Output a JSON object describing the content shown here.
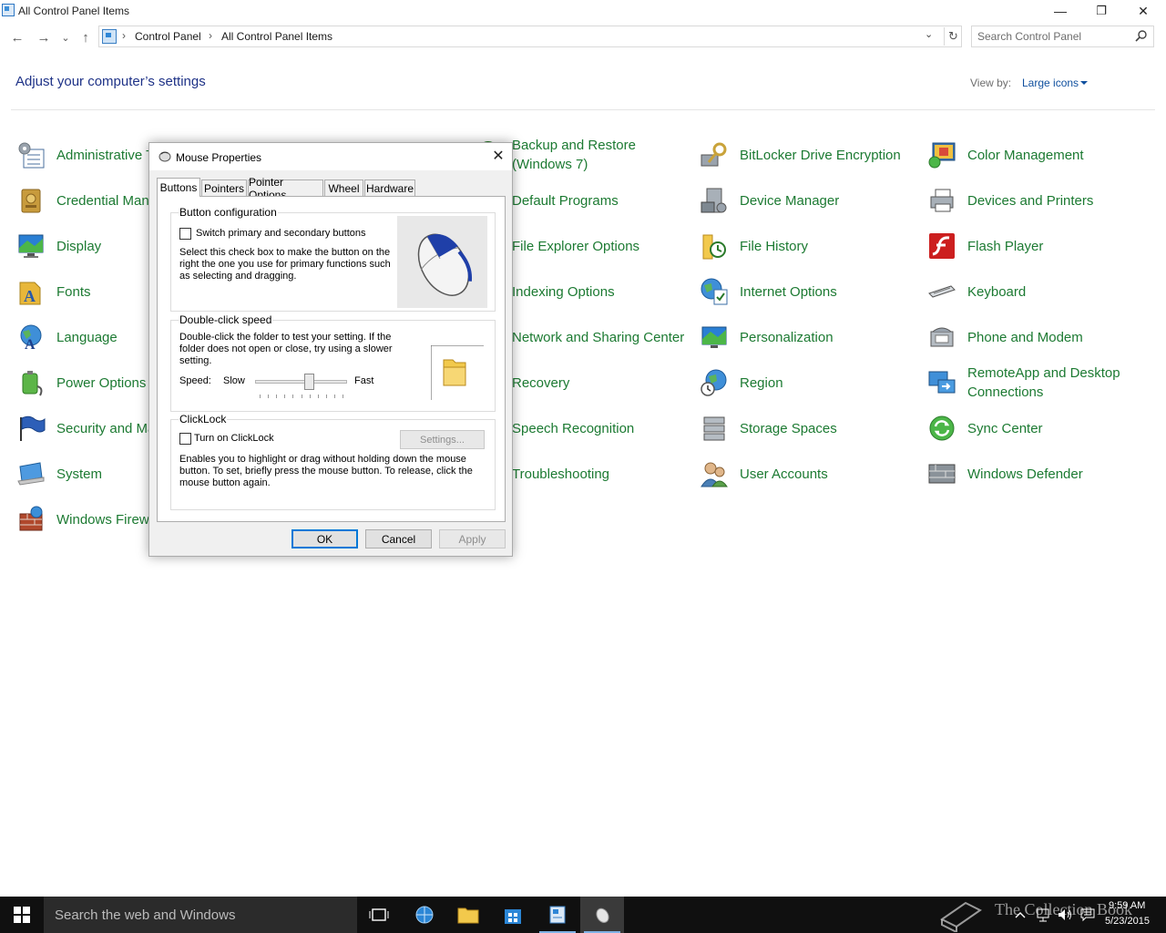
{
  "window": {
    "title": "All Control Panel Items",
    "minimize": "—",
    "restore": "❐",
    "close": "✕"
  },
  "nav": {
    "back": "←",
    "forward": "→",
    "recent": "⌄",
    "up": "↑",
    "breadcrumb": [
      "Control Panel",
      "All Control Panel Items"
    ],
    "sep": "›",
    "dropdown": "⌄",
    "refresh": "↻",
    "search_placeholder": "Search Control Panel"
  },
  "header": {
    "title": "Adjust your computer’s settings",
    "view_by_label": "View by:",
    "view_by_value": "Large icons"
  },
  "items": [
    {
      "label": "Administrative Tools",
      "icon": "administrative-tools-icon"
    },
    {
      "label": "Credential Manager",
      "icon": "credential-manager-icon"
    },
    {
      "label": "Display",
      "icon": "display-icon"
    },
    {
      "label": "Fonts",
      "icon": "fonts-icon"
    },
    {
      "label": "Language",
      "icon": "language-icon"
    },
    {
      "label": "Power Options",
      "icon": "power-options-icon"
    },
    {
      "label": "Security and Maintenance",
      "icon": "security-flag-icon"
    },
    {
      "label": "System",
      "icon": "system-icon"
    },
    {
      "label": "Windows Firewall",
      "icon": "firewall-icon"
    },
    {
      "label": "Backup and Restore (Windows 7)",
      "icon": "backup-icon"
    },
    {
      "label": "Default Programs",
      "icon": "default-programs-icon"
    },
    {
      "label": "File Explorer Options",
      "icon": "file-explorer-options-icon"
    },
    {
      "label": "Indexing Options",
      "icon": "indexing-options-icon"
    },
    {
      "label": "Network and Sharing Center",
      "icon": "network-icon"
    },
    {
      "label": "Recovery",
      "icon": "recovery-icon"
    },
    {
      "label": "Speech Recognition",
      "icon": "speech-recognition-icon"
    },
    {
      "label": "Troubleshooting",
      "icon": "troubleshooting-icon"
    },
    {
      "label": "BitLocker Drive Encryption",
      "icon": "bitlocker-icon"
    },
    {
      "label": "Device Manager",
      "icon": "device-manager-icon"
    },
    {
      "label": "File History",
      "icon": "file-history-icon"
    },
    {
      "label": "Internet Options",
      "icon": "internet-options-icon"
    },
    {
      "label": "Personalization",
      "icon": "personalization-icon"
    },
    {
      "label": "Region",
      "icon": "region-icon"
    },
    {
      "label": "Storage Spaces",
      "icon": "storage-spaces-icon"
    },
    {
      "label": "User Accounts",
      "icon": "user-accounts-icon"
    },
    {
      "label": "Color Management",
      "icon": "color-management-icon"
    },
    {
      "label": "Devices and Printers",
      "icon": "devices-printers-icon"
    },
    {
      "label": "Flash Player",
      "icon": "flash-player-icon"
    },
    {
      "label": "Keyboard",
      "icon": "keyboard-icon"
    },
    {
      "label": "Phone and Modem",
      "icon": "phone-modem-icon"
    },
    {
      "label": "RemoteApp and Desktop Connections",
      "icon": "remoteapp-icon"
    },
    {
      "label": "Sync Center",
      "icon": "sync-center-icon"
    },
    {
      "label": "Windows Defender",
      "icon": "windows-defender-icon"
    }
  ],
  "dialog": {
    "title": "Mouse Properties",
    "close": "✕",
    "tabs": [
      "Buttons",
      "Pointers",
      "Pointer Options",
      "Wheel",
      "Hardware"
    ],
    "active_tab": "Buttons",
    "button_config": {
      "group": "Button configuration",
      "checkbox_label": "Switch primary and secondary buttons",
      "checked": false,
      "description": "Select this check box to make the button on the right the one you use for primary functions such as selecting and dragging."
    },
    "double_click": {
      "group": "Double-click speed",
      "description": "Double-click the folder to test your setting. If the folder does not open or close, try using a slower setting.",
      "speed_label": "Speed:",
      "slow": "Slow",
      "fast": "Fast",
      "speed_level": 0.6
    },
    "clicklock": {
      "group": "ClickLock",
      "checkbox_label": "Turn on ClickLock",
      "checked": false,
      "settings_button": "Settings...",
      "description": "Enables you to highlight or drag without holding down the mouse button. To set, briefly press the mouse button. To release, click the mouse button again."
    },
    "ok": "OK",
    "cancel": "Cancel",
    "apply": "Apply"
  },
  "taskbar": {
    "search_text": "Search the web and Windows",
    "time": "9:59 AM",
    "date": "5/23/2015",
    "watermark": "The Collection Book"
  },
  "colors": {
    "link_green": "#1c7a32",
    "title_blue": "#1e3287",
    "accent": "#0078d7",
    "taskbar": "#101010"
  }
}
